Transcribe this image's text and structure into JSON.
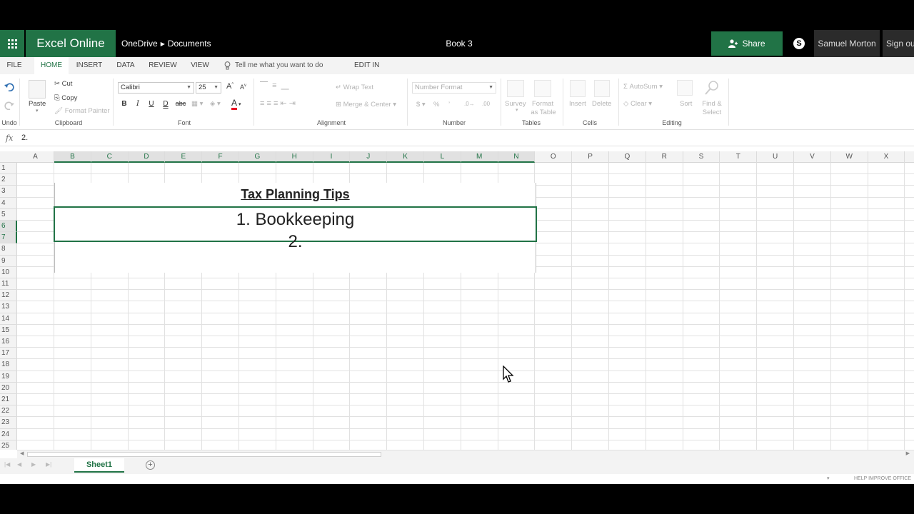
{
  "app": {
    "name": "Excel Online",
    "breadcrumb": [
      "OneDrive",
      "Documents"
    ],
    "document_title": "Book 3",
    "share_label": "Share",
    "user_name": "Samuel Morton",
    "sign_out": "Sign ou"
  },
  "ribbon_tabs": [
    "FILE",
    "HOME",
    "INSERT",
    "DATA",
    "REVIEW",
    "VIEW"
  ],
  "active_tab": "HOME",
  "tell_me": "Tell me what you want to do",
  "edit_in_excel": "EDIT IN EXCEL",
  "ribbon": {
    "undo_label": "Undo",
    "clipboard": {
      "paste": "Paste",
      "cut": "Cut",
      "copy": "Copy",
      "format_painter": "Format Painter",
      "label": "Clipboard"
    },
    "font": {
      "name": "Calibri",
      "size": "25",
      "label": "Font",
      "bold": "B",
      "italic": "I",
      "underline": "U",
      "double_underline": "D",
      "strike": "abc",
      "grow": "A",
      "shrink": "A",
      "font_color_glyph": "A",
      "font_color": "#e81123"
    },
    "alignment": {
      "wrap_text": "Wrap Text",
      "merge_center": "Merge & Center",
      "label": "Alignment"
    },
    "number": {
      "format": "Number Format",
      "currency": "$",
      "percent": "%",
      "label": "Number"
    },
    "tables": {
      "survey": "Survey",
      "format_as_table": [
        "Format",
        "as Table"
      ],
      "label": "Tables"
    },
    "cells": {
      "insert": "Insert",
      "delete": "Delete",
      "label": "Cells"
    },
    "editing": {
      "autosum": "AutoSum",
      "clear": "Clear",
      "sort": "Sort",
      "find_select": [
        "Find &",
        "Select"
      ],
      "label": "Editing"
    }
  },
  "formula_bar": {
    "fx": "fx",
    "value": "2."
  },
  "columns": [
    "A",
    "B",
    "C",
    "D",
    "E",
    "F",
    "G",
    "H",
    "I",
    "J",
    "K",
    "L",
    "M",
    "N",
    "O",
    "P",
    "Q",
    "R",
    "S",
    "T",
    "U",
    "V",
    "W",
    "X"
  ],
  "selected_columns": [
    "B",
    "C",
    "D",
    "E",
    "F",
    "G",
    "H",
    "I",
    "J",
    "K",
    "L",
    "M",
    "N"
  ],
  "rows": [
    "1",
    "2",
    "3",
    "4",
    "5",
    "6",
    "7",
    "8",
    "9",
    "10",
    "11",
    "12",
    "13",
    "14",
    "15",
    "16",
    "17",
    "18",
    "19",
    "20",
    "21",
    "22",
    "23",
    "24",
    "25"
  ],
  "selected_rows": [
    "6",
    "7"
  ],
  "cells": {
    "title": "Tax Planning Tips",
    "item1": "1. Bookkeeping",
    "item2": "2."
  },
  "sheet_tabs": [
    "Sheet1"
  ],
  "status": {
    "help": "HELP IMPROVE OFFICE"
  },
  "colors": {
    "accent": "#217346",
    "titlebar": "#000000"
  }
}
